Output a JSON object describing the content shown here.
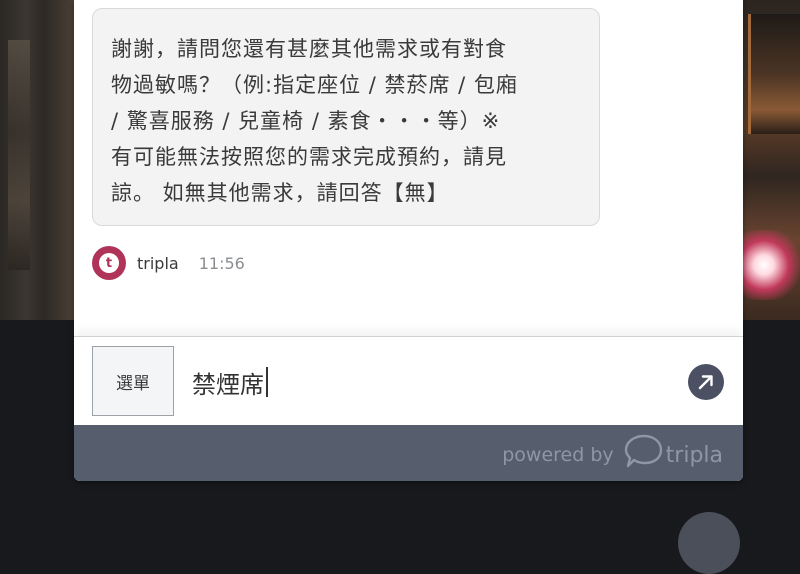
{
  "chat": {
    "bot_message_lines": [
      "謝謝，請問您還有甚麼其他需求或有對食",
      "物過敏嗎？（例:指定座位 / 禁菸席 / 包廂",
      "/ 驚喜服務 / 兒童椅 / 素食・・・等）※",
      "有可能無法按照您的需求完成預約，請見",
      "諒。 如無其他需求，請回答【無】"
    ],
    "sender_name": "tripla",
    "avatar_letter": "t",
    "timestamp": "11:56"
  },
  "input_bar": {
    "menu_label": "選單",
    "input_value": "禁煙席",
    "send_icon": "arrow-up-right-icon"
  },
  "footer": {
    "powered_by": "powered by",
    "brand": "tripla"
  },
  "colors": {
    "avatar": "#b0345a",
    "footer_bg": "#565d6d",
    "send_button": "#4b5162",
    "bubble_bg": "#f3f3f4"
  }
}
